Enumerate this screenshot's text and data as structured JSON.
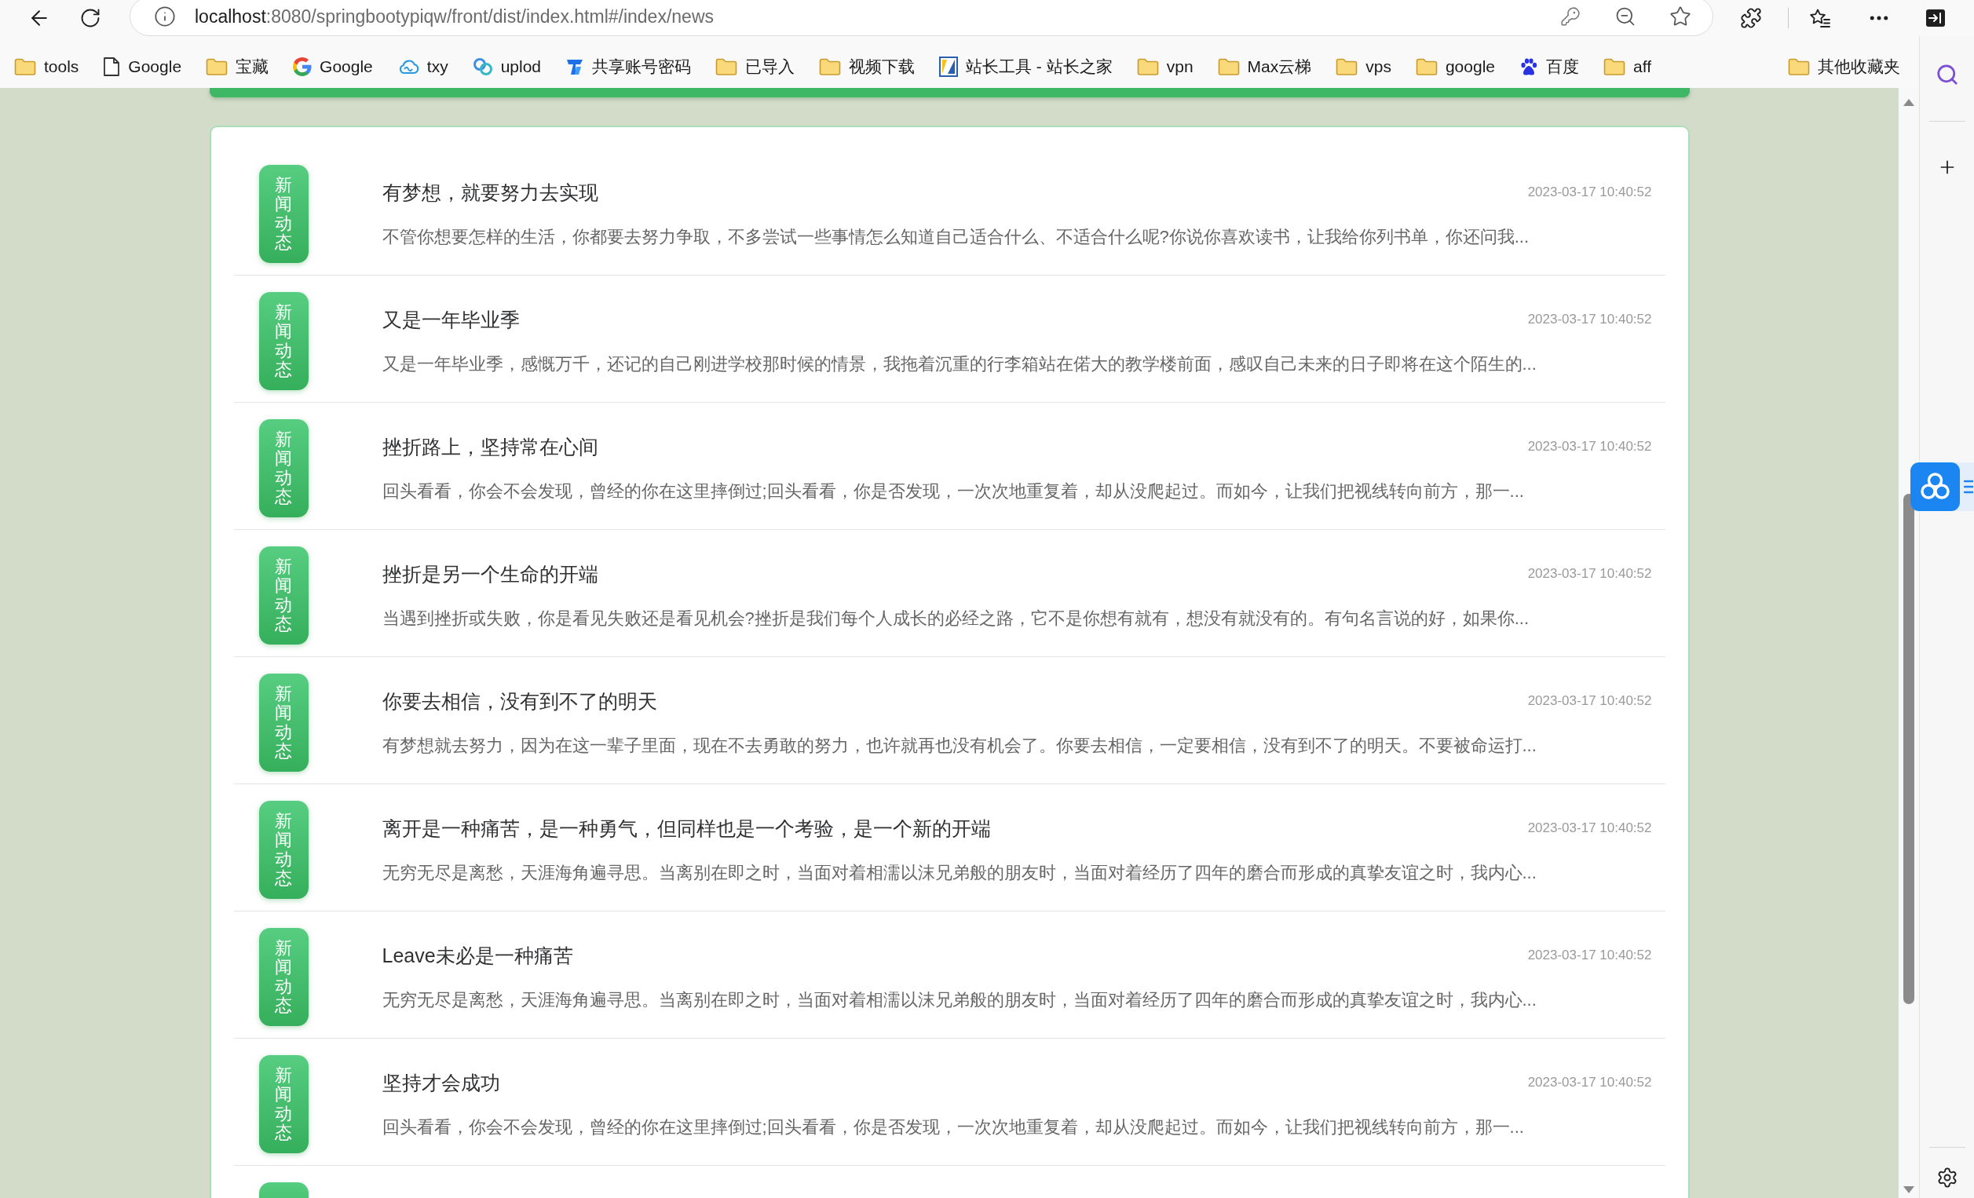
{
  "browser": {
    "url": {
      "host": "localhost",
      "path": ":8080/springbootypiqw/front/dist/index.html#/index/news"
    }
  },
  "bookmarks": [
    {
      "label": "tools",
      "kind": "folder"
    },
    {
      "label": "Google",
      "kind": "page"
    },
    {
      "label": "宝藏",
      "kind": "folder"
    },
    {
      "label": "Google",
      "kind": "glogo"
    },
    {
      "label": "txy",
      "kind": "cloud"
    },
    {
      "label": "uplod",
      "kind": "circles"
    },
    {
      "label": "共享账号密码",
      "kind": "tile"
    },
    {
      "label": "已导入",
      "kind": "folder"
    },
    {
      "label": "视频下载",
      "kind": "folder"
    },
    {
      "label": "站长工具 - 站长之家",
      "kind": "split"
    },
    {
      "label": "vpn",
      "kind": "folder"
    },
    {
      "label": "Max云梯",
      "kind": "folder"
    },
    {
      "label": "vps",
      "kind": "folder"
    },
    {
      "label": "google",
      "kind": "folder"
    },
    {
      "label": "百度",
      "kind": "paw"
    },
    {
      "label": "aff",
      "kind": "folder"
    }
  ],
  "other_bookmarks": {
    "label": "其他收藏夹",
    "kind": "folder"
  },
  "news": [
    {
      "badge": "新闻动态",
      "title": "有梦想，就要努力去实现",
      "date": "2023-03-17 10:40:52",
      "summary": "不管你想要怎样的生活，你都要去努力争取，不多尝试一些事情怎么知道自己适合什么、不适合什么呢?你说你喜欢读书，让我给你列书单，你还问我..."
    },
    {
      "badge": "新闻动态",
      "title": "又是一年毕业季",
      "date": "2023-03-17 10:40:52",
      "summary": "又是一年毕业季，感慨万千，还记的自己刚进学校那时候的情景，我拖着沉重的行李箱站在偌大的教学楼前面，感叹自己未来的日子即将在这个陌生的..."
    },
    {
      "badge": "新闻动态",
      "title": "挫折路上，坚持常在心间",
      "date": "2023-03-17 10:40:52",
      "summary": "回头看看，你会不会发现，曾经的你在这里摔倒过;回头看看，你是否发现，一次次地重复着，却从没爬起过。而如今，让我们把视线转向前方，那一..."
    },
    {
      "badge": "新闻动态",
      "title": "挫折是另一个生命的开端",
      "date": "2023-03-17 10:40:52",
      "summary": "当遇到挫折或失败，你是看见失败还是看见机会?挫折是我们每个人成长的必经之路，它不是你想有就有，想没有就没有的。有句名言说的好，如果你..."
    },
    {
      "badge": "新闻动态",
      "title": "你要去相信，没有到不了的明天",
      "date": "2023-03-17 10:40:52",
      "summary": "有梦想就去努力，因为在这一辈子里面，现在不去勇敢的努力，也许就再也没有机会了。你要去相信，一定要相信，没有到不了的明天。不要被命运打..."
    },
    {
      "badge": "新闻动态",
      "title": "离开是一种痛苦，是一种勇气，但同样也是一个考验，是一个新的开端",
      "date": "2023-03-17 10:40:52",
      "summary": "无穷无尽是离愁，天涯海角遍寻思。当离别在即之时，当面对着相濡以沫兄弟般的朋友时，当面对着经历了四年的磨合而形成的真挚友谊之时，我内心..."
    },
    {
      "badge": "新闻动态",
      "title": "Leave未必是一种痛苦",
      "date": "2023-03-17 10:40:52",
      "summary": "无穷无尽是离愁，天涯海角遍寻思。当离别在即之时，当面对着相濡以沫兄弟般的朋友时，当面对着经历了四年的磨合而形成的真挚友谊之时，我内心..."
    },
    {
      "badge": "新闻动态",
      "title": "坚持才会成功",
      "date": "2023-03-17 10:40:52",
      "summary": "回头看看，你会不会发现，曾经的你在这里摔倒过;回头看看，你是否发现，一次次地重复着，却从没爬起过。而如今，让我们把视线转向前方，那一..."
    }
  ]
}
